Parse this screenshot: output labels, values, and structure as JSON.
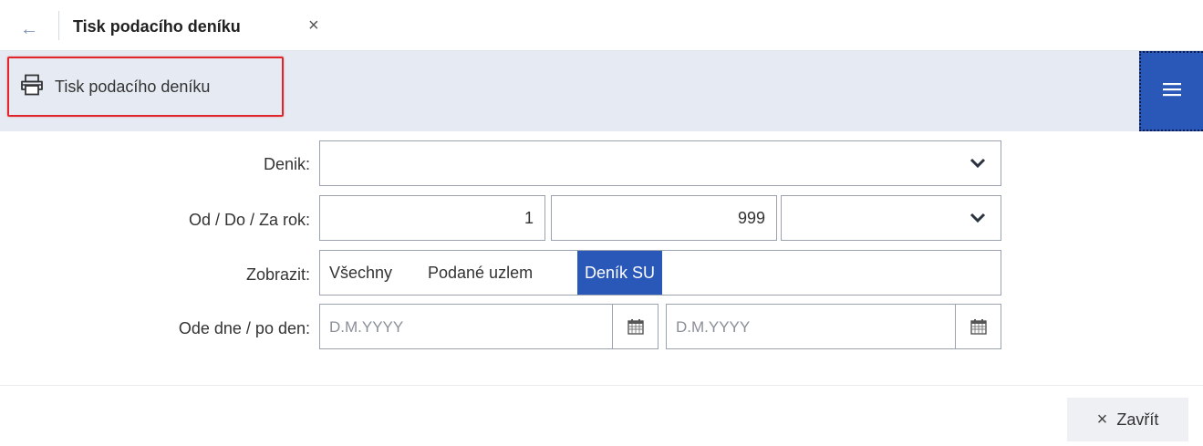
{
  "tab": {
    "title": "Tisk podacího deníku",
    "close_glyph": "×",
    "back_glyph": "←"
  },
  "toolbar": {
    "print_label": "Tisk podacího deníku",
    "print_icon": "printer-icon",
    "menu_icon": "hamburger-menu-icon"
  },
  "form": {
    "denik": {
      "label": "Denik:",
      "value": ""
    },
    "range": {
      "label": "Od / Do / Za rok:",
      "from": "1",
      "to": "999",
      "year": ""
    },
    "zobrazit": {
      "label": "Zobrazit:",
      "options": [
        "Všechny",
        "Podané uzlem",
        "Deník SU"
      ],
      "selected": "Deník SU"
    },
    "dates": {
      "label": "Ode dne / po den:",
      "from_placeholder": "D.M.YYYY",
      "to_placeholder": "D.M.YYYY"
    }
  },
  "footer": {
    "close_label": "Zavřít",
    "close_glyph": "×"
  },
  "colors": {
    "accent": "#2a58b8",
    "toolbar_bg": "#e6ebf3",
    "highlight_border": "#e0262b",
    "border": "#9aa3af"
  }
}
